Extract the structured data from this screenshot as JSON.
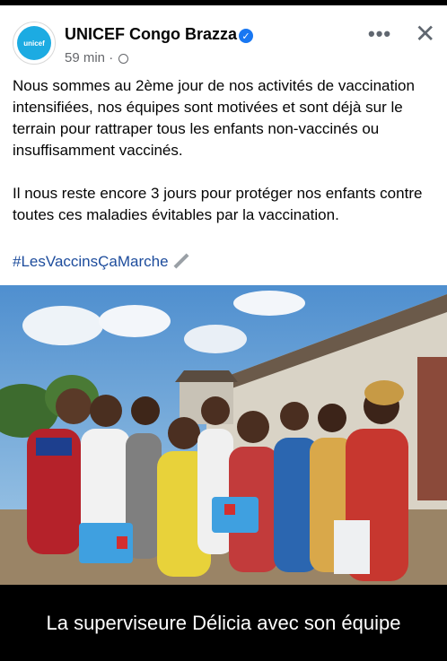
{
  "post": {
    "page_name": "UNICEF Congo Brazza",
    "avatar_text": "unicef",
    "time": "59 min",
    "separator": "·",
    "more_label": "•••",
    "close_label": "✕",
    "verified_icon": "✓",
    "paragraph1": "Nous sommes au 2ème jour de nos activités de vaccination intensifiées,  nos équipes sont motivées et sont déjà sur le terrain pour rattraper tous les enfants non-vaccinés ou insuffisamment vaccinés.",
    "paragraph2": "Il nous reste encore 3 jours pour protéger nos enfants contre toutes ces maladies évitables par la vaccination.",
    "hashtag": "#LesVaccinsÇaMarche"
  },
  "caption": {
    "text": "La superviseure Délicia avec son équipe"
  },
  "colors": {
    "brand": "#1CABE2",
    "verified": "#1877F2",
    "hashtag": "#1D4C9C"
  },
  "icons": [
    "unicef-logo-icon",
    "verified-badge-icon",
    "globe-icon",
    "more-options-icon",
    "close-icon",
    "syringe-icon"
  ]
}
